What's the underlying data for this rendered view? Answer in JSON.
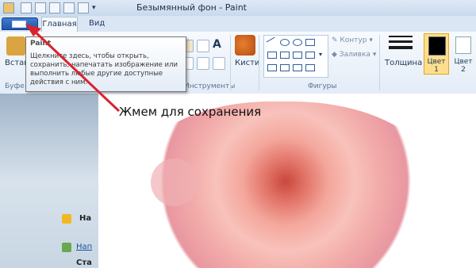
{
  "window": {
    "title": "Безымянный фон - Paint"
  },
  "tabs": {
    "home": "Главная",
    "view": "Вид"
  },
  "ribbon": {
    "paste_label": "Встав",
    "clipboard_group": "Буфе",
    "tools_group": "Инструменты",
    "brushes_label": "Кисти",
    "shapes_group": "Фигуры",
    "outline_label": "Контур",
    "fill_label": "Заливка",
    "thickness_label": "Толщина",
    "color1_label": "Цвет 1",
    "color2_label": "Цвет 2"
  },
  "tooltip": {
    "title": "Paint",
    "body": "Щелкните здесь, чтобы открыть, сохранить, напечатать изображение или выполнить любые другие доступные действия с ним."
  },
  "annotation": {
    "text": "Жмем для сохранения",
    "color": "#d9232d"
  },
  "left_panel": {
    "item1": "На",
    "item2": "Нап",
    "item3": "Ста"
  },
  "colors": {
    "ribbon_accent": "#1e57ab",
    "color1": "#000000",
    "color2": "#ffffff"
  }
}
